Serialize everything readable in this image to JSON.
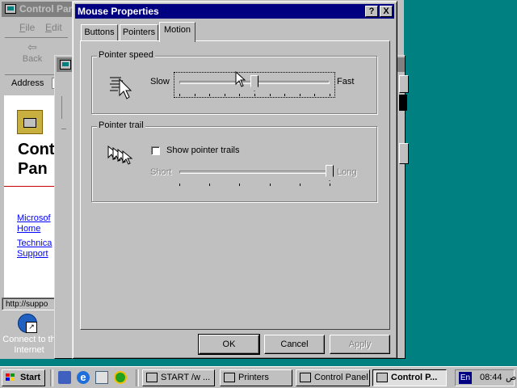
{
  "background_window": {
    "title": "Control Par",
    "menu": [
      "File",
      "Edit"
    ],
    "back_label": "Back",
    "address_label": "Address",
    "page_heading_line1": "Cont",
    "page_heading_line2": "Pan",
    "links": [
      "Microsof",
      "Home",
      "Technica",
      "Support"
    ],
    "status_text": "http://suppo"
  },
  "desktop": {
    "icon_label_line1": "Connect to th",
    "icon_label_line2": "Internet"
  },
  "dialog": {
    "title": "Mouse Properties",
    "title_buttons": [
      "?",
      "X"
    ],
    "tabs": [
      {
        "label": "Buttons",
        "active": false
      },
      {
        "label": "Pointers",
        "active": false
      },
      {
        "label": "Motion",
        "active": true
      }
    ],
    "pointer_speed": {
      "group_label": "Pointer speed",
      "min_label": "Slow",
      "max_label": "Fast",
      "value_fraction": 0.5
    },
    "pointer_trail": {
      "group_label": "Pointer trail",
      "checkbox_label": "Show pointer trails",
      "checked": false,
      "min_label": "Short",
      "max_label": "Long",
      "value_fraction": 1.0,
      "enabled": false
    },
    "buttons": {
      "ok": "OK",
      "cancel": "Cancel",
      "apply": "Apply"
    }
  },
  "taskbar": {
    "start_label": "Start",
    "tasks": [
      {
        "label": "START /w ...",
        "pressed": false
      },
      {
        "label": "Printers",
        "pressed": false
      },
      {
        "label": "Control Panel",
        "pressed": false
      },
      {
        "label": "Control P...",
        "pressed": true
      }
    ],
    "tray": {
      "language": "En",
      "time": "08:44",
      "ampm": "ص"
    }
  }
}
